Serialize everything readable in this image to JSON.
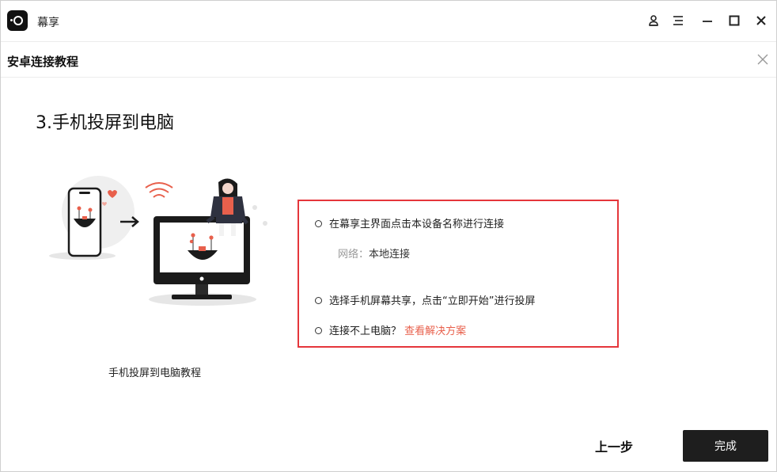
{
  "window": {
    "app_title": "幕享"
  },
  "titlebar_icons": [
    "user-icon",
    "menu-icon",
    "minimize-icon",
    "maximize-icon",
    "close-icon"
  ],
  "dialog": {
    "title": "安卓连接教程",
    "step_title": "3.手机投屏到电脑",
    "illustration_caption": "手机投屏到电脑教程",
    "instructions": {
      "item1": "在幕享主界面点击本设备名称进行连接",
      "network_label": "网络：",
      "network_value": "本地连接",
      "item2": "选择手机屏幕共享，点击“立即开始”进行投屏",
      "item3_text": "连接不上电脑？",
      "item3_link": "查看解决方案"
    },
    "prev_button": "上一步",
    "done_button": "完成"
  },
  "colors": {
    "highlight_border": "#e5363b",
    "link": "#e8604c",
    "primary_button": "#1e1e1e"
  }
}
